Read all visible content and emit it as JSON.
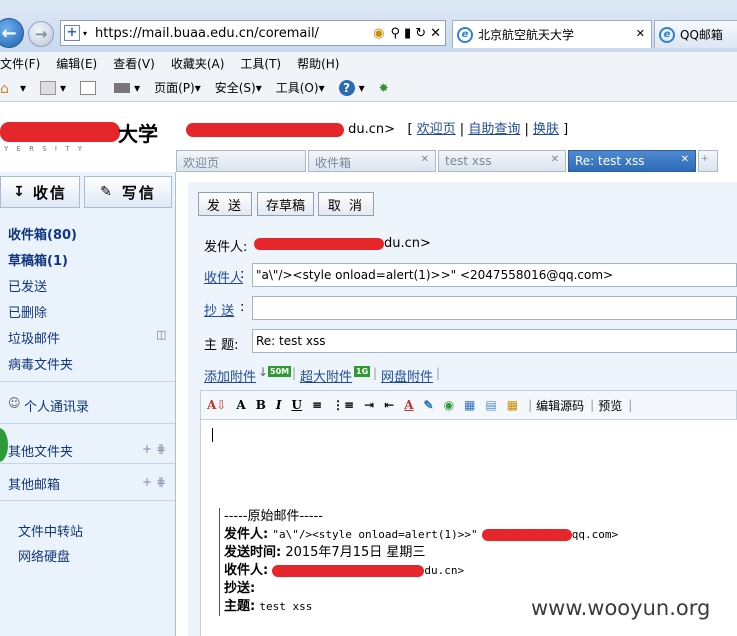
{
  "browser": {
    "url": "https://mail.buaa.edu.cn/coremail/",
    "tabs": [
      {
        "label": "北京航空航天大学",
        "active": true
      },
      {
        "label": "QQ邮箱",
        "active": false
      }
    ],
    "menu": [
      "文件(F)",
      "编辑(E)",
      "查看(V)",
      "收藏夹(A)",
      "工具(T)",
      "帮助(H)"
    ],
    "toolbar": {
      "page": "页面(P)",
      "safety": "安全(S)",
      "tools": "工具(O)"
    }
  },
  "header": {
    "logo_suffix": "大学",
    "email_suffix": "du.cn>",
    "links": [
      "欢迎页",
      "自助查询",
      "换肤"
    ]
  },
  "inner_tabs": [
    {
      "label": "欢迎页",
      "active": false
    },
    {
      "label": "收件箱",
      "active": false
    },
    {
      "label": "test xss",
      "active": false
    },
    {
      "label": "Re: test xss",
      "active": true
    }
  ],
  "sidebar": {
    "receive_button": "收信",
    "compose_button": "写信",
    "folders": [
      "收件箱(80)",
      "草稿箱(1)",
      "已发送",
      "已删除",
      "垃圾邮件",
      "病毒文件夹"
    ],
    "contacts": "个人通讯录",
    "other_folders": "其他文件夹",
    "other_mailboxes": "其他邮箱",
    "services": [
      "文件中转站",
      "网络硬盘"
    ]
  },
  "compose": {
    "buttons": [
      "发 送",
      "存草稿",
      "取 消"
    ],
    "from_label": "发件人:",
    "from_value": "du.cn>",
    "to_label": "收件人",
    "to_value": "\"a\\\"/><style onload=alert(1)>>\" <2047558016@qq.com>",
    "cc_label": "抄 送",
    "subject_label": "主 题:",
    "subject_value": "Re: test xss",
    "attachments": [
      "添加附件",
      "超大附件",
      "网盘附件"
    ],
    "badges": [
      "50M",
      "1G"
    ],
    "editor_tools": [
      "编辑源码",
      "预览"
    ]
  },
  "quote": {
    "divider": "-----原始邮件-----",
    "from_label": "发件人:",
    "from_value": "\"a\\\"/><style onload=alert(1)>>\"",
    "from_tail": "qq.com>",
    "sent_label": "发送时间:",
    "sent_value": "2015年7月15日 星期三",
    "to_label": "收件人:",
    "to_tail": "du.cn>",
    "cc_label": "抄送:",
    "subject_label": "主题:",
    "subject_value": "test xss"
  },
  "watermark": "www.wooyun.org",
  "colors": {
    "accent": "#2e6bb8",
    "link": "#1f4b99",
    "redaction": "#e5262a"
  }
}
